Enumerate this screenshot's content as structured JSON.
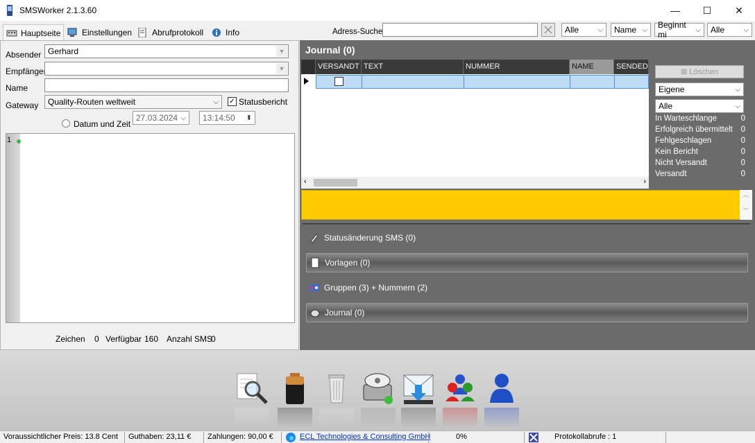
{
  "window": {
    "title": "SMSWorker 2.1.3.60"
  },
  "tabs": [
    {
      "label": "Hauptseite"
    },
    {
      "label": "Einstellungen"
    },
    {
      "label": "Abrufprotokoll"
    },
    {
      "label": "Info"
    }
  ],
  "search": {
    "label": "Adress-Suche",
    "value": "",
    "filter1": "Alle",
    "filter2": "Name",
    "filter3": "Beginnt mi",
    "filter4": "Alle"
  },
  "form": {
    "absender_label": "Absender",
    "absender_value": "Gerhard",
    "empfaenger_label": "Empfänger",
    "empfaenger_value": "",
    "name_label": "Name",
    "name_value": "",
    "gateway_label": "Gateway",
    "gateway_value": "Quality-Routen weltweit",
    "statusbericht_label": "Statusbericht",
    "statusbericht_checked": true,
    "datum_label": "Datum und Zeit",
    "date_value": "27.03.2024",
    "time_value": "13:14:50",
    "line_number": "1"
  },
  "counters": {
    "zeichen_label": "Zeichen",
    "zeichen_value": "0",
    "verfuegbar_label": "Verfügbar",
    "verfuegbar_value": "160",
    "anzahl_label": "Anzahl SMS",
    "anzahl_value": "0"
  },
  "journal": {
    "title": "Journal (0)",
    "columns": [
      "VERSANDT",
      "TEXT",
      "NUMMER",
      "NAME",
      "SENDED"
    ],
    "loeschen_label": "Löschen",
    "filter_eigene": "Eigene",
    "filter_alle": "Alle",
    "stats": [
      {
        "label": "In Warteschlange",
        "value": "0"
      },
      {
        "label": "Erfolgreich übermittelt",
        "value": "0"
      },
      {
        "label": "Fehlgeschlagen",
        "value": "0"
      },
      {
        "label": "Kein Bericht",
        "value": "0"
      },
      {
        "label": "Nicht Versandt",
        "value": "0"
      },
      {
        "label": "Versandt",
        "value": "0"
      }
    ]
  },
  "sections": [
    {
      "label": "Statusänderung SMS (0)"
    },
    {
      "label": "Vorlagen (0)"
    },
    {
      "label": "Gruppen (3) + Nummern (2)"
    },
    {
      "label": "Journal (0)"
    }
  ],
  "statusbar": {
    "preis": "Voraussichtlicher Preis: 13.8 Cent",
    "guthaben": "Guthaben: 23,11 €",
    "zahlungen": "Zahlungen: 90,00 €",
    "company": "ECL Technologies & Consulting GmbH",
    "progress": "0%",
    "protokoll": "Protokollabrufe : 1"
  },
  "colors": {
    "panel_dark": "#6b6b6b",
    "highlight_yellow": "#ffcc00",
    "row_selected": "#bfdcf7"
  }
}
